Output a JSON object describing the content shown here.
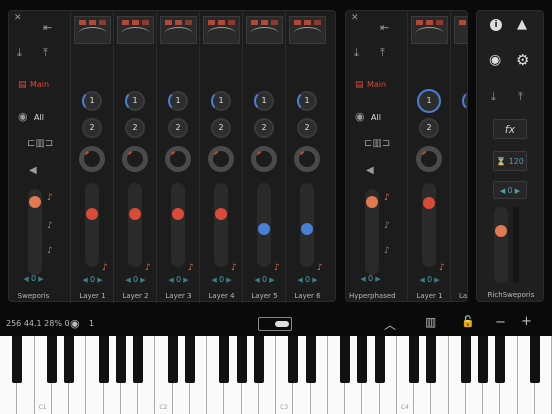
{
  "panelA": {
    "routing": {
      "group_label": "Main",
      "midi_label": "All",
      "value": "0"
    },
    "master": {
      "label": "Sweporis"
    },
    "layers": [
      {
        "label": "Layer 1",
        "send1": "1",
        "send2": "2",
        "fader_color": "red",
        "value": "0"
      },
      {
        "label": "Layer 2",
        "send1": "1",
        "send2": "2",
        "fader_color": "red",
        "value": "0"
      },
      {
        "label": "Layer 3",
        "send1": "1",
        "send2": "2",
        "fader_color": "red",
        "value": "0"
      },
      {
        "label": "Layer 4",
        "send1": "1",
        "send2": "2",
        "fader_color": "red",
        "value": "0"
      },
      {
        "label": "Layer 5",
        "send1": "1",
        "send2": "2",
        "fader_color": "blue",
        "value": "0"
      },
      {
        "label": "Layer 6",
        "send1": "1",
        "send2": "2",
        "fader_color": "blue",
        "value": "0"
      }
    ]
  },
  "panelB": {
    "routing": {
      "group_label": "Main",
      "midi_label": "All",
      "value": "0"
    },
    "master": {
      "label": "Hyperphased"
    },
    "layer": {
      "label": "Layer 1",
      "send1": "1",
      "send2": "2",
      "value": "0"
    },
    "partial_label": "La"
  },
  "panelC": {
    "fx_label": "fx",
    "tempo": "120",
    "value": "0",
    "label": "RichSweporis"
  },
  "toolbar": {
    "stats": "256  44.1  28%  0",
    "channel": "1"
  },
  "keyboard": {
    "octave_labels": [
      "C1",
      "C2",
      "C3",
      "C4"
    ]
  },
  "colors": {
    "accent_red": "#d94a37",
    "accent_blue": "#4a7fd6",
    "teal": "#4fa0a8"
  }
}
